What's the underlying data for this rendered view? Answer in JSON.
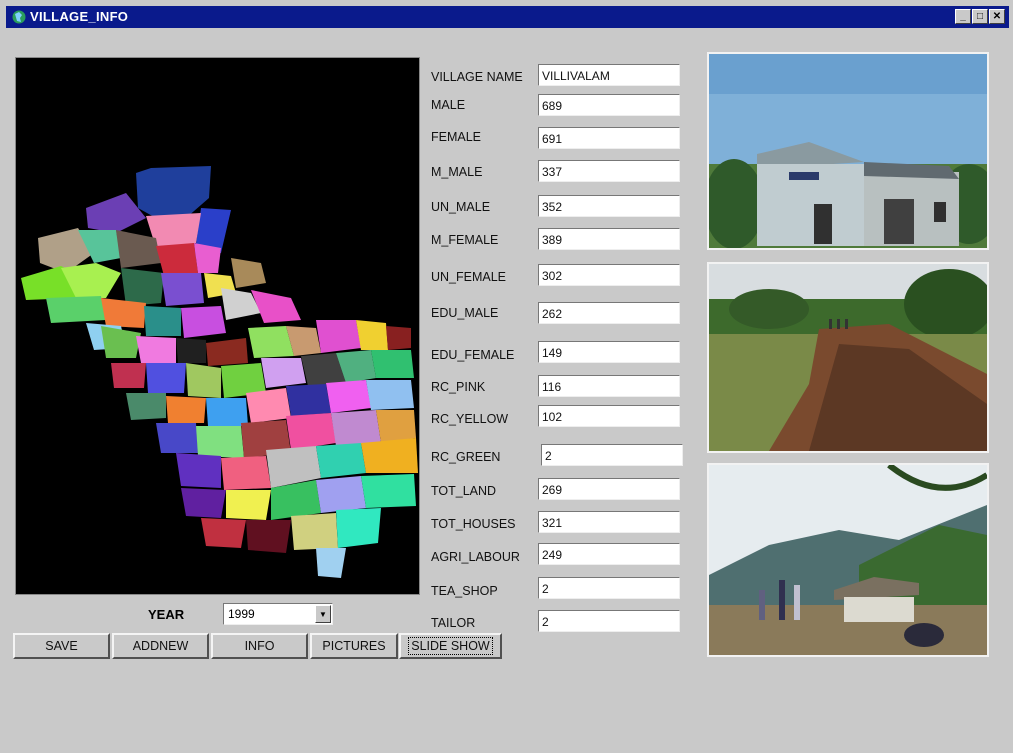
{
  "window": {
    "title": "VILLAGE_INFO"
  },
  "fields": [
    {
      "key": "village_name",
      "label": "VILLAGE NAME",
      "value": "VILLIVALAM"
    },
    {
      "key": "male",
      "label": "MALE",
      "value": "689"
    },
    {
      "key": "female",
      "label": "FEMALE",
      "value": "691"
    },
    {
      "key": "m_male",
      "label": "M_MALE",
      "value": "337"
    },
    {
      "key": "un_male",
      "label": "UN_MALE",
      "value": "352"
    },
    {
      "key": "m_female",
      "label": "M_FEMALE",
      "value": "389"
    },
    {
      "key": "un_female",
      "label": "UN_FEMALE",
      "value": "302"
    },
    {
      "key": "edu_male",
      "label": "EDU_MALE",
      "value": "262"
    },
    {
      "key": "edu_female",
      "label": "EDU_FEMALE",
      "value": "149"
    },
    {
      "key": "rc_pink",
      "label": "RC_PINK",
      "value": "116"
    },
    {
      "key": "rc_yellow",
      "label": "RC_YELLOW",
      "value": "102"
    },
    {
      "key": "rc_green",
      "label": "RC_GREEN",
      "value": "2"
    },
    {
      "key": "tot_land",
      "label": "TOT_LAND",
      "value": "269"
    },
    {
      "key": "tot_houses",
      "label": "TOT_HOUSES",
      "value": "321"
    },
    {
      "key": "agri_labour",
      "label": "AGRI_LABOUR",
      "value": "249"
    },
    {
      "key": "tea_shop",
      "label": "TEA_SHOP",
      "value": "2"
    },
    {
      "key": "tailor",
      "label": "TAILOR",
      "value": "2"
    }
  ],
  "year": {
    "label": "YEAR",
    "value": "1999"
  },
  "buttons": {
    "save": "SAVE",
    "addnew": "ADDNEW",
    "info": "INFO",
    "pictures": "PICTURES",
    "slideshow": "SLIDE SHOW"
  },
  "map": {
    "background": "#000000",
    "icon": "region-map"
  },
  "photos": [
    {
      "icon": "school-building-photo"
    },
    {
      "icon": "rocky-field-photo"
    },
    {
      "icon": "hut-village-photo"
    }
  ]
}
